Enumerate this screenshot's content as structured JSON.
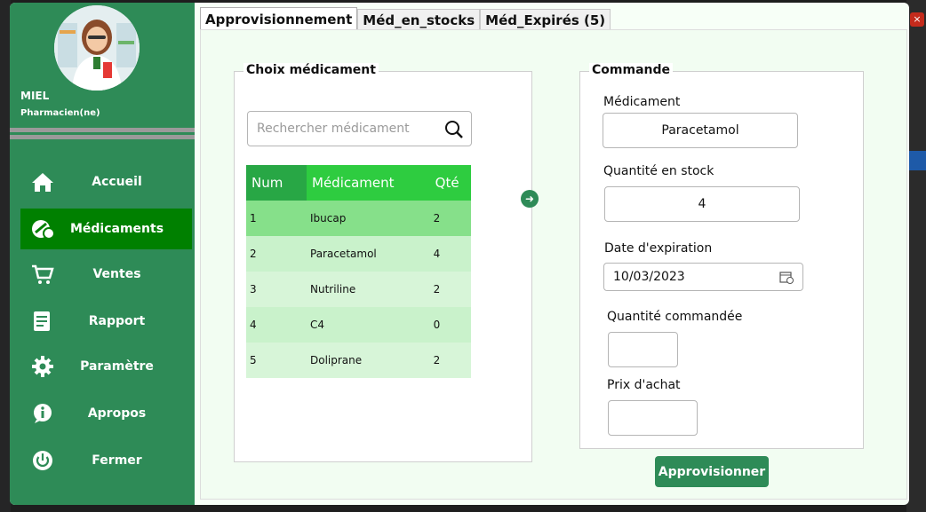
{
  "user": {
    "name": "MIEL",
    "role": "Pharmacien(ne)"
  },
  "sidebar": {
    "items": [
      {
        "label": "Accueil",
        "icon": "home-icon"
      },
      {
        "label": "Médicaments",
        "icon": "pill-icon",
        "active": true
      },
      {
        "label": "Ventes",
        "icon": "cart-icon"
      },
      {
        "label": "Rapport",
        "icon": "report-icon"
      },
      {
        "label": "Paramètre",
        "icon": "gear-icon"
      },
      {
        "label": "Apropos",
        "icon": "info-icon"
      },
      {
        "label": "Fermer",
        "icon": "power-icon"
      }
    ]
  },
  "tabs": [
    {
      "label": "Approvisionnement",
      "active": true
    },
    {
      "label": "Méd_en_stocks"
    },
    {
      "label": "Méd_Expirés (5)"
    }
  ],
  "choice": {
    "title": "Choix médicament",
    "search_placeholder": "Rechercher médicament",
    "columns": [
      "Num",
      "Médicament",
      "Qté"
    ],
    "rows": [
      [
        "1",
        "Ibucap",
        "2"
      ],
      [
        "2",
        "Paracetamol",
        "4"
      ],
      [
        "3",
        "Nutriline",
        "2"
      ],
      [
        "4",
        "C4",
        "0"
      ],
      [
        "5",
        "Doliprane",
        "2"
      ]
    ]
  },
  "order": {
    "title": "Commande",
    "medicament_label": "Médicament",
    "medicament_value": "Paracetamol",
    "stock_label": "Quantité en stock",
    "stock_value": "4",
    "expiry_label": "Date d'expiration",
    "expiry_value": "10/03/2023",
    "qty_label": "Quantité commandée",
    "qty_value": "",
    "price_label": "Prix d'achat",
    "price_value": "",
    "submit_label": "Approvisionner"
  },
  "colors": {
    "sidebar": "#2e8b57",
    "active": "#008000",
    "header": "#2ecc40"
  }
}
